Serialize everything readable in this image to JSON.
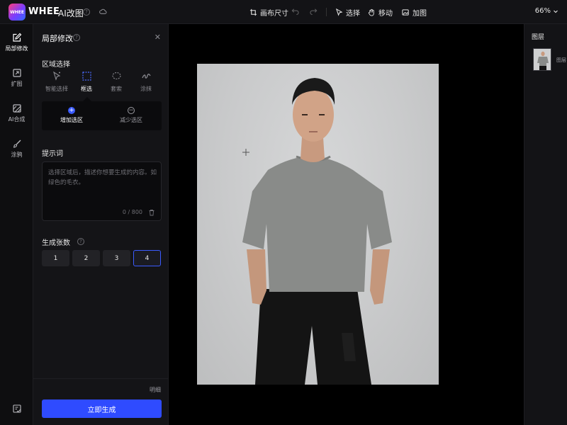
{
  "topbar": {
    "logo_text": "WHEE",
    "brand": "WHEE",
    "product": "AI改图",
    "canvas_size": "画布尺寸",
    "select": "选择",
    "move": "移动",
    "add_image": "加图",
    "zoom": "66%"
  },
  "rail": {
    "items": [
      {
        "label": "局部修改",
        "icon": "brush-edit-icon",
        "active": true
      },
      {
        "label": "扩图",
        "icon": "expand-icon",
        "active": false
      },
      {
        "label": "AI合成",
        "icon": "ai-compose-icon",
        "active": false
      },
      {
        "label": "涂鸦",
        "icon": "paintbrush-icon",
        "active": false
      }
    ]
  },
  "panel": {
    "title": "局部修改",
    "region_label": "区域选择",
    "tools": [
      {
        "label": "智能选择",
        "icon": "smart-select-icon",
        "active": false
      },
      {
        "label": "框选",
        "icon": "box-select-icon",
        "active": true
      },
      {
        "label": "套索",
        "icon": "lasso-icon",
        "active": false
      },
      {
        "label": "涂抹",
        "icon": "smear-icon",
        "active": false
      }
    ],
    "sub_options": [
      {
        "label": "增加选区",
        "icon": "plus-circle-icon",
        "active": true
      },
      {
        "label": "减少选区",
        "icon": "minus-circle-icon",
        "active": false
      }
    ],
    "prompt_label": "提示词",
    "prompt_placeholder": "选择区域后，描述你想要生成的内容。如绿色的毛衣。",
    "prompt_count": "0 / 800",
    "count_label": "生成张数",
    "counts": [
      "1",
      "2",
      "3",
      "4"
    ],
    "selected_count": "4",
    "detail": "明细",
    "generate": "立即生成"
  },
  "layers": {
    "title": "图层",
    "items": [
      {
        "name": "图层"
      }
    ]
  },
  "colors": {
    "accent": "#2f4bff",
    "background": "#0b0b0d",
    "panel": "#141417"
  }
}
